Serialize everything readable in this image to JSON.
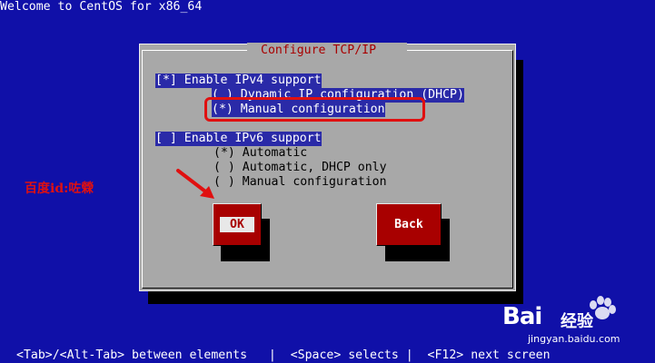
{
  "screen": {
    "title": "Welcome to CentOS for x86_64",
    "hint_bar": "<Tab>/<Alt-Tab> between elements   |  <Space> selects |  <F12> next screen"
  },
  "dialog": {
    "title": "Configure TCP/IP",
    "ipv4": {
      "checkbox": "[*] Enable IPv4 support",
      "dhcp": "( ) Dynamic IP configuration (DHCP)",
      "manual": "(*) Manual configuration"
    },
    "ipv6": {
      "checkbox": "[ ] Enable IPv6 support",
      "auto": "(*) Automatic",
      "auto_dhcp": "( ) Automatic, DHCP only",
      "manual": "( ) Manual configuration"
    },
    "ok_label": "OK",
    "back_label": "Back"
  },
  "overlay": {
    "watermark_text": "百度id:咗檾",
    "baidu_brand": "Bai",
    "baidu_sub": "经验",
    "baidu_url": "jingyan.baidu.com"
  },
  "colors": {
    "background": "#1010a8",
    "dialog": "#a8a8a8",
    "selection": "#2a2aa8",
    "button": "#a80000",
    "annotation": "#e01010"
  }
}
